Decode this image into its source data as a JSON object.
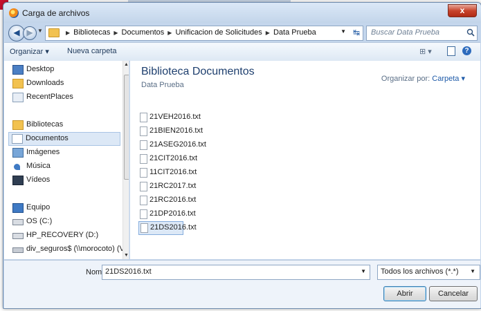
{
  "dialog": {
    "title": "Carga de archivos",
    "close_label": "x"
  },
  "address_bar": {
    "crumbs": [
      "Bibliotecas",
      "Documentos",
      "Unificacion de Solicitudes",
      "Data Prueba"
    ],
    "search_placeholder": "Buscar Data Prueba"
  },
  "toolbar": {
    "organize_label": "Organizar ▾",
    "new_folder_label": "Nueva carpeta",
    "views_label": "⊞ ▾",
    "help_label": "?"
  },
  "nav": {
    "items": [
      {
        "label": "Desktop",
        "icon": "desktop-icon"
      },
      {
        "label": "Downloads",
        "icon": "downloads-folder-icon"
      },
      {
        "label": "RecentPlaces",
        "icon": "recent-places-icon"
      },
      {
        "label": "Bibliotecas",
        "icon": "libraries-icon"
      },
      {
        "label": "Documentos",
        "icon": "documents-icon"
      },
      {
        "label": "Imágenes",
        "icon": "pictures-icon"
      },
      {
        "label": "Música",
        "icon": "music-icon"
      },
      {
        "label": "Vídeos",
        "icon": "videos-icon"
      },
      {
        "label": "Equipo",
        "icon": "computer-icon"
      },
      {
        "label": "OS (C:)",
        "icon": "drive-icon"
      },
      {
        "label": "HP_RECOVERY (D:)",
        "icon": "drive-icon"
      },
      {
        "label": "div_seguros$ (\\\\morocoto) (V:)",
        "icon": "network-drive-icon"
      }
    ],
    "selected": "Documentos"
  },
  "content": {
    "library_title": "Biblioteca Documentos",
    "library_subtitle": "Data Prueba",
    "arrange_label": "Organizar por:",
    "arrange_value": "Carpeta ▾",
    "files": [
      "21VEH2016.txt",
      "21BIEN2016.txt",
      "21ASEG2016.txt",
      "21CIT2016.txt",
      "11CIT2016.txt",
      "21RC2017.txt",
      "21RC2016.txt",
      "21DP2016.txt",
      "21DS2016.txt"
    ],
    "selected_file": "21DS2016.txt"
  },
  "footer": {
    "filename_label": "Nombre:",
    "filename_value": "21DS2016.txt",
    "filetype_value": "Todos los archivos (*.*)",
    "open_label": "Abrir",
    "cancel_label": "Cancelar"
  },
  "colors": {
    "accent": "#1e5aa8",
    "selection": "#dce8f6",
    "frame": "#c4d6ec"
  }
}
